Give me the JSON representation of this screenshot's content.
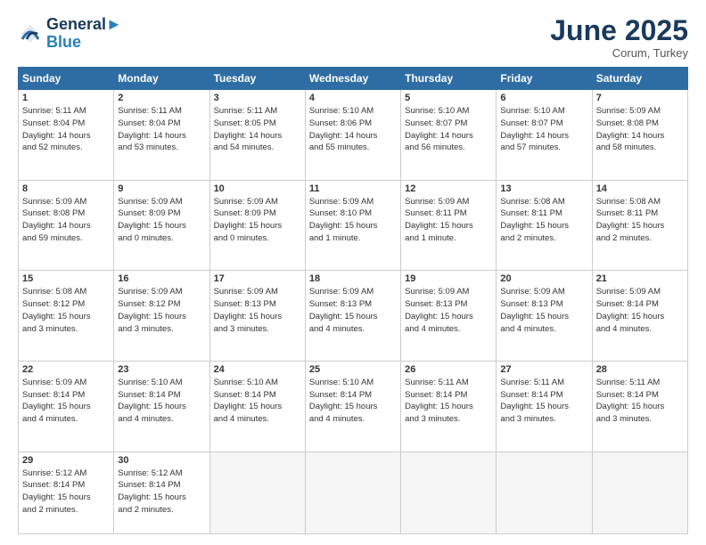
{
  "header": {
    "logo_line1": "General",
    "logo_line2": "Blue",
    "month": "June 2025",
    "location": "Corum, Turkey"
  },
  "days_of_week": [
    "Sunday",
    "Monday",
    "Tuesday",
    "Wednesday",
    "Thursday",
    "Friday",
    "Saturday"
  ],
  "weeks": [
    [
      {
        "day": "1",
        "lines": [
          "Sunrise: 5:11 AM",
          "Sunset: 8:04 PM",
          "Daylight: 14 hours",
          "and 52 minutes."
        ]
      },
      {
        "day": "2",
        "lines": [
          "Sunrise: 5:11 AM",
          "Sunset: 8:04 PM",
          "Daylight: 14 hours",
          "and 53 minutes."
        ]
      },
      {
        "day": "3",
        "lines": [
          "Sunrise: 5:11 AM",
          "Sunset: 8:05 PM",
          "Daylight: 14 hours",
          "and 54 minutes."
        ]
      },
      {
        "day": "4",
        "lines": [
          "Sunrise: 5:10 AM",
          "Sunset: 8:06 PM",
          "Daylight: 14 hours",
          "and 55 minutes."
        ]
      },
      {
        "day": "5",
        "lines": [
          "Sunrise: 5:10 AM",
          "Sunset: 8:07 PM",
          "Daylight: 14 hours",
          "and 56 minutes."
        ]
      },
      {
        "day": "6",
        "lines": [
          "Sunrise: 5:10 AM",
          "Sunset: 8:07 PM",
          "Daylight: 14 hours",
          "and 57 minutes."
        ]
      },
      {
        "day": "7",
        "lines": [
          "Sunrise: 5:09 AM",
          "Sunset: 8:08 PM",
          "Daylight: 14 hours",
          "and 58 minutes."
        ]
      }
    ],
    [
      {
        "day": "8",
        "lines": [
          "Sunrise: 5:09 AM",
          "Sunset: 8:08 PM",
          "Daylight: 14 hours",
          "and 59 minutes."
        ]
      },
      {
        "day": "9",
        "lines": [
          "Sunrise: 5:09 AM",
          "Sunset: 8:09 PM",
          "Daylight: 15 hours",
          "and 0 minutes."
        ]
      },
      {
        "day": "10",
        "lines": [
          "Sunrise: 5:09 AM",
          "Sunset: 8:09 PM",
          "Daylight: 15 hours",
          "and 0 minutes."
        ]
      },
      {
        "day": "11",
        "lines": [
          "Sunrise: 5:09 AM",
          "Sunset: 8:10 PM",
          "Daylight: 15 hours",
          "and 1 minute."
        ]
      },
      {
        "day": "12",
        "lines": [
          "Sunrise: 5:09 AM",
          "Sunset: 8:11 PM",
          "Daylight: 15 hours",
          "and 1 minute."
        ]
      },
      {
        "day": "13",
        "lines": [
          "Sunrise: 5:08 AM",
          "Sunset: 8:11 PM",
          "Daylight: 15 hours",
          "and 2 minutes."
        ]
      },
      {
        "day": "14",
        "lines": [
          "Sunrise: 5:08 AM",
          "Sunset: 8:11 PM",
          "Daylight: 15 hours",
          "and 2 minutes."
        ]
      }
    ],
    [
      {
        "day": "15",
        "lines": [
          "Sunrise: 5:08 AM",
          "Sunset: 8:12 PM",
          "Daylight: 15 hours",
          "and 3 minutes."
        ]
      },
      {
        "day": "16",
        "lines": [
          "Sunrise: 5:09 AM",
          "Sunset: 8:12 PM",
          "Daylight: 15 hours",
          "and 3 minutes."
        ]
      },
      {
        "day": "17",
        "lines": [
          "Sunrise: 5:09 AM",
          "Sunset: 8:13 PM",
          "Daylight: 15 hours",
          "and 3 minutes."
        ]
      },
      {
        "day": "18",
        "lines": [
          "Sunrise: 5:09 AM",
          "Sunset: 8:13 PM",
          "Daylight: 15 hours",
          "and 4 minutes."
        ]
      },
      {
        "day": "19",
        "lines": [
          "Sunrise: 5:09 AM",
          "Sunset: 8:13 PM",
          "Daylight: 15 hours",
          "and 4 minutes."
        ]
      },
      {
        "day": "20",
        "lines": [
          "Sunrise: 5:09 AM",
          "Sunset: 8:13 PM",
          "Daylight: 15 hours",
          "and 4 minutes."
        ]
      },
      {
        "day": "21",
        "lines": [
          "Sunrise: 5:09 AM",
          "Sunset: 8:14 PM",
          "Daylight: 15 hours",
          "and 4 minutes."
        ]
      }
    ],
    [
      {
        "day": "22",
        "lines": [
          "Sunrise: 5:09 AM",
          "Sunset: 8:14 PM",
          "Daylight: 15 hours",
          "and 4 minutes."
        ]
      },
      {
        "day": "23",
        "lines": [
          "Sunrise: 5:10 AM",
          "Sunset: 8:14 PM",
          "Daylight: 15 hours",
          "and 4 minutes."
        ]
      },
      {
        "day": "24",
        "lines": [
          "Sunrise: 5:10 AM",
          "Sunset: 8:14 PM",
          "Daylight: 15 hours",
          "and 4 minutes."
        ]
      },
      {
        "day": "25",
        "lines": [
          "Sunrise: 5:10 AM",
          "Sunset: 8:14 PM",
          "Daylight: 15 hours",
          "and 4 minutes."
        ]
      },
      {
        "day": "26",
        "lines": [
          "Sunrise: 5:11 AM",
          "Sunset: 8:14 PM",
          "Daylight: 15 hours",
          "and 3 minutes."
        ]
      },
      {
        "day": "27",
        "lines": [
          "Sunrise: 5:11 AM",
          "Sunset: 8:14 PM",
          "Daylight: 15 hours",
          "and 3 minutes."
        ]
      },
      {
        "day": "28",
        "lines": [
          "Sunrise: 5:11 AM",
          "Sunset: 8:14 PM",
          "Daylight: 15 hours",
          "and 3 minutes."
        ]
      }
    ],
    [
      {
        "day": "29",
        "lines": [
          "Sunrise: 5:12 AM",
          "Sunset: 8:14 PM",
          "Daylight: 15 hours",
          "and 2 minutes."
        ]
      },
      {
        "day": "30",
        "lines": [
          "Sunrise: 5:12 AM",
          "Sunset: 8:14 PM",
          "Daylight: 15 hours",
          "and 2 minutes."
        ]
      },
      {
        "day": "",
        "lines": []
      },
      {
        "day": "",
        "lines": []
      },
      {
        "day": "",
        "lines": []
      },
      {
        "day": "",
        "lines": []
      },
      {
        "day": "",
        "lines": []
      }
    ]
  ]
}
